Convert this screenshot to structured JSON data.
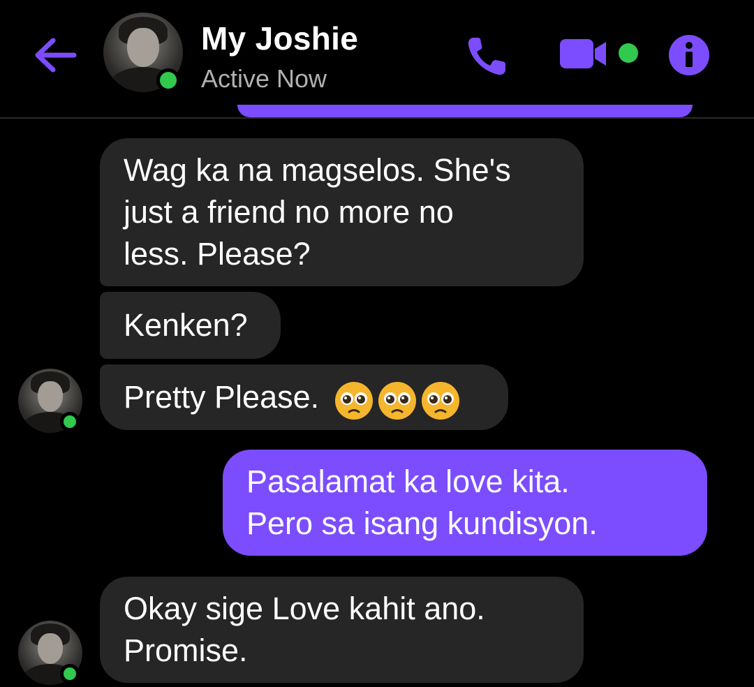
{
  "header": {
    "contact_name": "My Joshie",
    "status_text": "Active Now",
    "back_icon": "arrow-left-icon",
    "call_icon": "phone-icon",
    "video_icon": "video-camera-icon",
    "info_icon": "info-icon"
  },
  "colors": {
    "accent": "#7c4dff",
    "incoming_bubble": "#262626",
    "online": "#31c94e",
    "background": "#000000"
  },
  "messages": [
    {
      "direction": "incoming",
      "lines": [
        "Wag ka na magselos. She's",
        "just a friend no more no",
        "less. Please?"
      ]
    },
    {
      "direction": "incoming",
      "lines": [
        "Kenken?"
      ]
    },
    {
      "direction": "incoming",
      "lines": [
        "Pretty Please."
      ],
      "emoji": "pleading-face-emoji x3"
    },
    {
      "direction": "outgoing",
      "lines": [
        "Pasalamat ka love kita.",
        "Pero sa isang kundisyon."
      ]
    },
    {
      "direction": "incoming",
      "lines": [
        "Okay sige Love kahit ano.",
        "Promise."
      ]
    }
  ]
}
